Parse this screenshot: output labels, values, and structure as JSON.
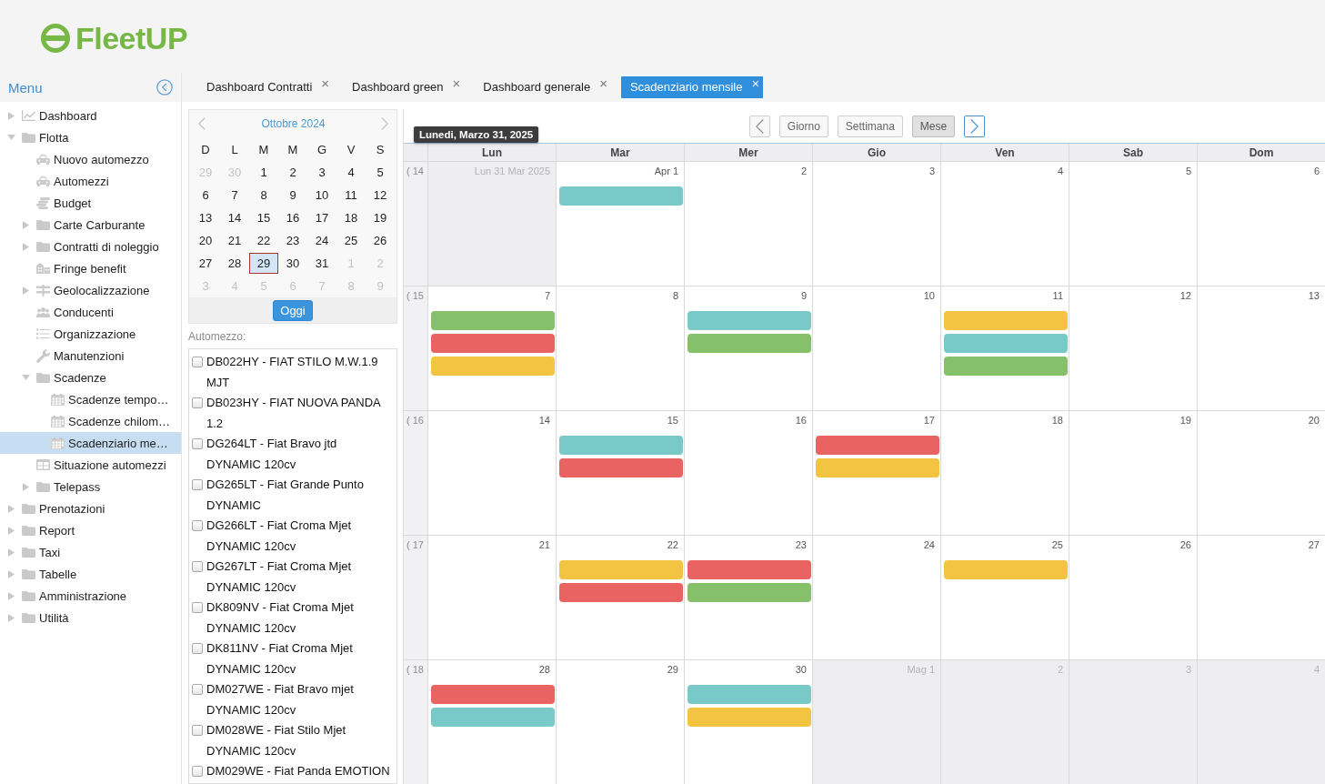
{
  "logo": {
    "text": "FleetUP"
  },
  "sidebar": {
    "title": "Menu",
    "items": [
      {
        "label": "Dashboard",
        "kind": "chart",
        "expanded": false,
        "selected": false
      },
      {
        "label": "Flotta",
        "kind": "folder",
        "expanded": true,
        "selected": false,
        "children": [
          {
            "label": "Nuovo automezzo",
            "kind": "car",
            "selected": false
          },
          {
            "label": "Automezzi",
            "kind": "car",
            "selected": false
          },
          {
            "label": "Budget",
            "kind": "coins",
            "selected": false
          },
          {
            "label": "Carte Carburante",
            "kind": "folder",
            "expanded": false,
            "selected": false
          },
          {
            "label": "Contratti di noleggio",
            "kind": "folder",
            "expanded": false,
            "selected": false
          },
          {
            "label": "Fringe benefit",
            "kind": "buildings",
            "selected": false
          },
          {
            "label": "Geolocalizzazione",
            "kind": "signpost",
            "expanded": false,
            "selected": false
          },
          {
            "label": "Conducenti",
            "kind": "people",
            "selected": false
          },
          {
            "label": "Organizzazione",
            "kind": "list",
            "selected": false
          },
          {
            "label": "Manutenzioni",
            "kind": "wrench",
            "selected": false
          },
          {
            "label": "Scadenze",
            "kind": "folder",
            "expanded": true,
            "selected": false,
            "children": [
              {
                "label": "Scadenze tempo…",
                "kind": "calendar",
                "selected": false
              },
              {
                "label": "Scadenze chilom…",
                "kind": "calendar",
                "selected": false
              },
              {
                "label": "Scadenziario me…",
                "kind": "calendar",
                "selected": true
              }
            ]
          },
          {
            "label": "Situazione automezzi",
            "kind": "table",
            "selected": false
          },
          {
            "label": "Telepass",
            "kind": "folder",
            "expanded": false,
            "selected": false
          }
        ]
      },
      {
        "label": "Prenotazioni",
        "kind": "folder",
        "expanded": false,
        "selected": false
      },
      {
        "label": "Report",
        "kind": "folder",
        "expanded": false,
        "selected": false
      },
      {
        "label": "Taxi",
        "kind": "folder",
        "expanded": false,
        "selected": false
      },
      {
        "label": "Tabelle",
        "kind": "folder",
        "expanded": false,
        "selected": false
      },
      {
        "label": "Amministrazione",
        "kind": "folder",
        "expanded": false,
        "selected": false
      },
      {
        "label": "Utilità",
        "kind": "folder",
        "expanded": false,
        "selected": false
      }
    ]
  },
  "tabs": [
    {
      "label": "Dashboard Contratti",
      "close": "×",
      "selected": false
    },
    {
      "label": "Dashboard green",
      "close": "×",
      "selected": false
    },
    {
      "label": "Dashboard generale",
      "close": "×",
      "selected": false
    },
    {
      "label": "Scadenziario mensile",
      "close": "×",
      "selected": true
    }
  ],
  "mini_calendar": {
    "title": "Ottobre 2024",
    "weekdays": [
      "D",
      "L",
      "M",
      "M",
      "G",
      "V",
      "S"
    ],
    "weeks": [
      [
        {
          "day": "29",
          "outside": true,
          "selected": false
        },
        {
          "day": "30",
          "outside": true,
          "selected": false
        },
        {
          "day": "1",
          "outside": false,
          "selected": false
        },
        {
          "day": "2",
          "outside": false,
          "selected": false
        },
        {
          "day": "3",
          "outside": false,
          "selected": false
        },
        {
          "day": "4",
          "outside": false,
          "selected": false
        },
        {
          "day": "5",
          "outside": false,
          "selected": false
        }
      ],
      [
        {
          "day": "6",
          "outside": false,
          "selected": false
        },
        {
          "day": "7",
          "outside": false,
          "selected": false
        },
        {
          "day": "8",
          "outside": false,
          "selected": false
        },
        {
          "day": "9",
          "outside": false,
          "selected": false
        },
        {
          "day": "10",
          "outside": false,
          "selected": false
        },
        {
          "day": "11",
          "outside": false,
          "selected": false
        },
        {
          "day": "12",
          "outside": false,
          "selected": false
        }
      ],
      [
        {
          "day": "13",
          "outside": false,
          "selected": false
        },
        {
          "day": "14",
          "outside": false,
          "selected": false
        },
        {
          "day": "15",
          "outside": false,
          "selected": false
        },
        {
          "day": "16",
          "outside": false,
          "selected": false
        },
        {
          "day": "17",
          "outside": false,
          "selected": false
        },
        {
          "day": "18",
          "outside": false,
          "selected": false
        },
        {
          "day": "19",
          "outside": false,
          "selected": false
        }
      ],
      [
        {
          "day": "20",
          "outside": false,
          "selected": false
        },
        {
          "day": "21",
          "outside": false,
          "selected": false
        },
        {
          "day": "22",
          "outside": false,
          "selected": false
        },
        {
          "day": "23",
          "outside": false,
          "selected": false
        },
        {
          "day": "24",
          "outside": false,
          "selected": false
        },
        {
          "day": "25",
          "outside": false,
          "selected": false
        },
        {
          "day": "26",
          "outside": false,
          "selected": false
        }
      ],
      [
        {
          "day": "27",
          "outside": false,
          "selected": false
        },
        {
          "day": "28",
          "outside": false,
          "selected": false
        },
        {
          "day": "29",
          "outside": false,
          "selected": true
        },
        {
          "day": "30",
          "outside": false,
          "selected": false
        },
        {
          "day": "31",
          "outside": false,
          "selected": false
        },
        {
          "day": "1",
          "outside": true,
          "selected": false
        },
        {
          "day": "2",
          "outside": true,
          "selected": false
        }
      ],
      [
        {
          "day": "3",
          "outside": true,
          "selected": false
        },
        {
          "day": "4",
          "outside": true,
          "selected": false
        },
        {
          "day": "5",
          "outside": true,
          "selected": false
        },
        {
          "day": "6",
          "outside": true,
          "selected": false
        },
        {
          "day": "7",
          "outside": true,
          "selected": false
        },
        {
          "day": "8",
          "outside": true,
          "selected": false
        },
        {
          "day": "9",
          "outside": true,
          "selected": false
        }
      ]
    ],
    "today_button": "Oggi"
  },
  "vehicle_filter": {
    "label": "Automezzo:",
    "vehicles": [
      {
        "name": "DB022HY - FIAT STILO M.W.1.9 MJT",
        "checked": false
      },
      {
        "name": "DB023HY - FIAT NUOVA PANDA 1.2",
        "checked": false
      },
      {
        "name": "DG264LT - Fiat Bravo jtd DYNAMIC 120cv",
        "checked": false
      },
      {
        "name": "DG265LT - Fiat Grande Punto DYNAMIC",
        "checked": false
      },
      {
        "name": "DG266LT - Fiat Croma Mjet DYNAMIC 120cv",
        "checked": false
      },
      {
        "name": "DG267LT - Fiat Croma Mjet DYNAMIC 120cv",
        "checked": false
      },
      {
        "name": "DK809NV - Fiat Croma Mjet DYNAMIC 120cv",
        "checked": false
      },
      {
        "name": "DK811NV - Fiat Croma Mjet DYNAMIC 120cv",
        "checked": false
      },
      {
        "name": "DM027WE - Fiat Bravo mjet DYNAMIC 120cv",
        "checked": false
      },
      {
        "name": "DM028WE - Fiat Stilo Mjet DYNAMIC 120cv",
        "checked": false
      },
      {
        "name": "DM029WE - Fiat Panda EMOTION",
        "checked": false
      }
    ]
  },
  "calendar": {
    "prev_button": {
      "focused": false
    },
    "views": [
      {
        "label": "Giorno",
        "selected": false
      },
      {
        "label": "Settimana",
        "selected": false
      },
      {
        "label": "Mese",
        "selected": true
      }
    ],
    "next_button": {
      "focused": true
    },
    "tooltip": "Lunedi, Marzo 31, 2025",
    "columns": [
      "Lun",
      "Mar",
      "Mer",
      "Gio",
      "Ven",
      "Sab",
      "Dom"
    ],
    "weeks": [
      {
        "marker": "(",
        "number": "14",
        "days": [
          {
            "label": "Lun 31 Mar 2025",
            "outside": true
          },
          {
            "label": "Apr 1",
            "outside": false,
            "events": [
              {
                "color": "#78c9c7"
              }
            ]
          },
          {
            "label": "2",
            "outside": false
          },
          {
            "label": "3",
            "outside": false
          },
          {
            "label": "4",
            "outside": false
          },
          {
            "label": "5",
            "outside": false
          },
          {
            "label": "6",
            "outside": false
          }
        ]
      },
      {
        "marker": "(",
        "number": "15",
        "days": [
          {
            "label": "7",
            "outside": false,
            "events": [
              {
                "color": "#86c06b"
              },
              {
                "color": "#e96363"
              },
              {
                "color": "#f3c441"
              }
            ]
          },
          {
            "label": "8",
            "outside": false
          },
          {
            "label": "9",
            "outside": false,
            "events": [
              {
                "color": "#78c9c7"
              },
              {
                "color": "#86c06b"
              }
            ]
          },
          {
            "label": "10",
            "outside": false
          },
          {
            "label": "11",
            "outside": false,
            "events": [
              {
                "color": "#f3c441"
              },
              {
                "color": "#78c9c7"
              },
              {
                "color": "#86c06b"
              }
            ]
          },
          {
            "label": "12",
            "outside": false
          },
          {
            "label": "13",
            "outside": false
          }
        ]
      },
      {
        "marker": "(",
        "number": "16",
        "days": [
          {
            "label": "14",
            "outside": false
          },
          {
            "label": "15",
            "outside": false,
            "events": [
              {
                "color": "#78c9c7"
              },
              {
                "color": "#e96363"
              }
            ]
          },
          {
            "label": "16",
            "outside": false
          },
          {
            "label": "17",
            "outside": false,
            "events": [
              {
                "color": "#e96363"
              },
              {
                "color": "#f3c441"
              }
            ]
          },
          {
            "label": "18",
            "outside": false
          },
          {
            "label": "19",
            "outside": false
          },
          {
            "label": "20",
            "outside": false
          }
        ]
      },
      {
        "marker": "(",
        "number": "17",
        "days": [
          {
            "label": "21",
            "outside": false
          },
          {
            "label": "22",
            "outside": false,
            "events": [
              {
                "color": "#f3c441"
              },
              {
                "color": "#e96363"
              }
            ]
          },
          {
            "label": "23",
            "outside": false,
            "events": [
              {
                "color": "#e96363"
              },
              {
                "color": "#86c06b"
              }
            ]
          },
          {
            "label": "24",
            "outside": false
          },
          {
            "label": "25",
            "outside": false,
            "events": [
              {
                "color": "#f3c441"
              }
            ]
          },
          {
            "label": "26",
            "outside": false
          },
          {
            "label": "27",
            "outside": false
          }
        ]
      },
      {
        "marker": "(",
        "number": "18",
        "days": [
          {
            "label": "28",
            "outside": false,
            "events": [
              {
                "color": "#e96363"
              },
              {
                "color": "#78c9c7"
              }
            ]
          },
          {
            "label": "29",
            "outside": false
          },
          {
            "label": "30",
            "outside": false,
            "events": [
              {
                "color": "#78c9c7"
              },
              {
                "color": "#f3c441"
              }
            ]
          },
          {
            "label": "Mag 1",
            "outside": true
          },
          {
            "label": "2",
            "outside": true
          },
          {
            "label": "3",
            "outside": true
          },
          {
            "label": "4",
            "outside": true
          }
        ]
      }
    ]
  }
}
